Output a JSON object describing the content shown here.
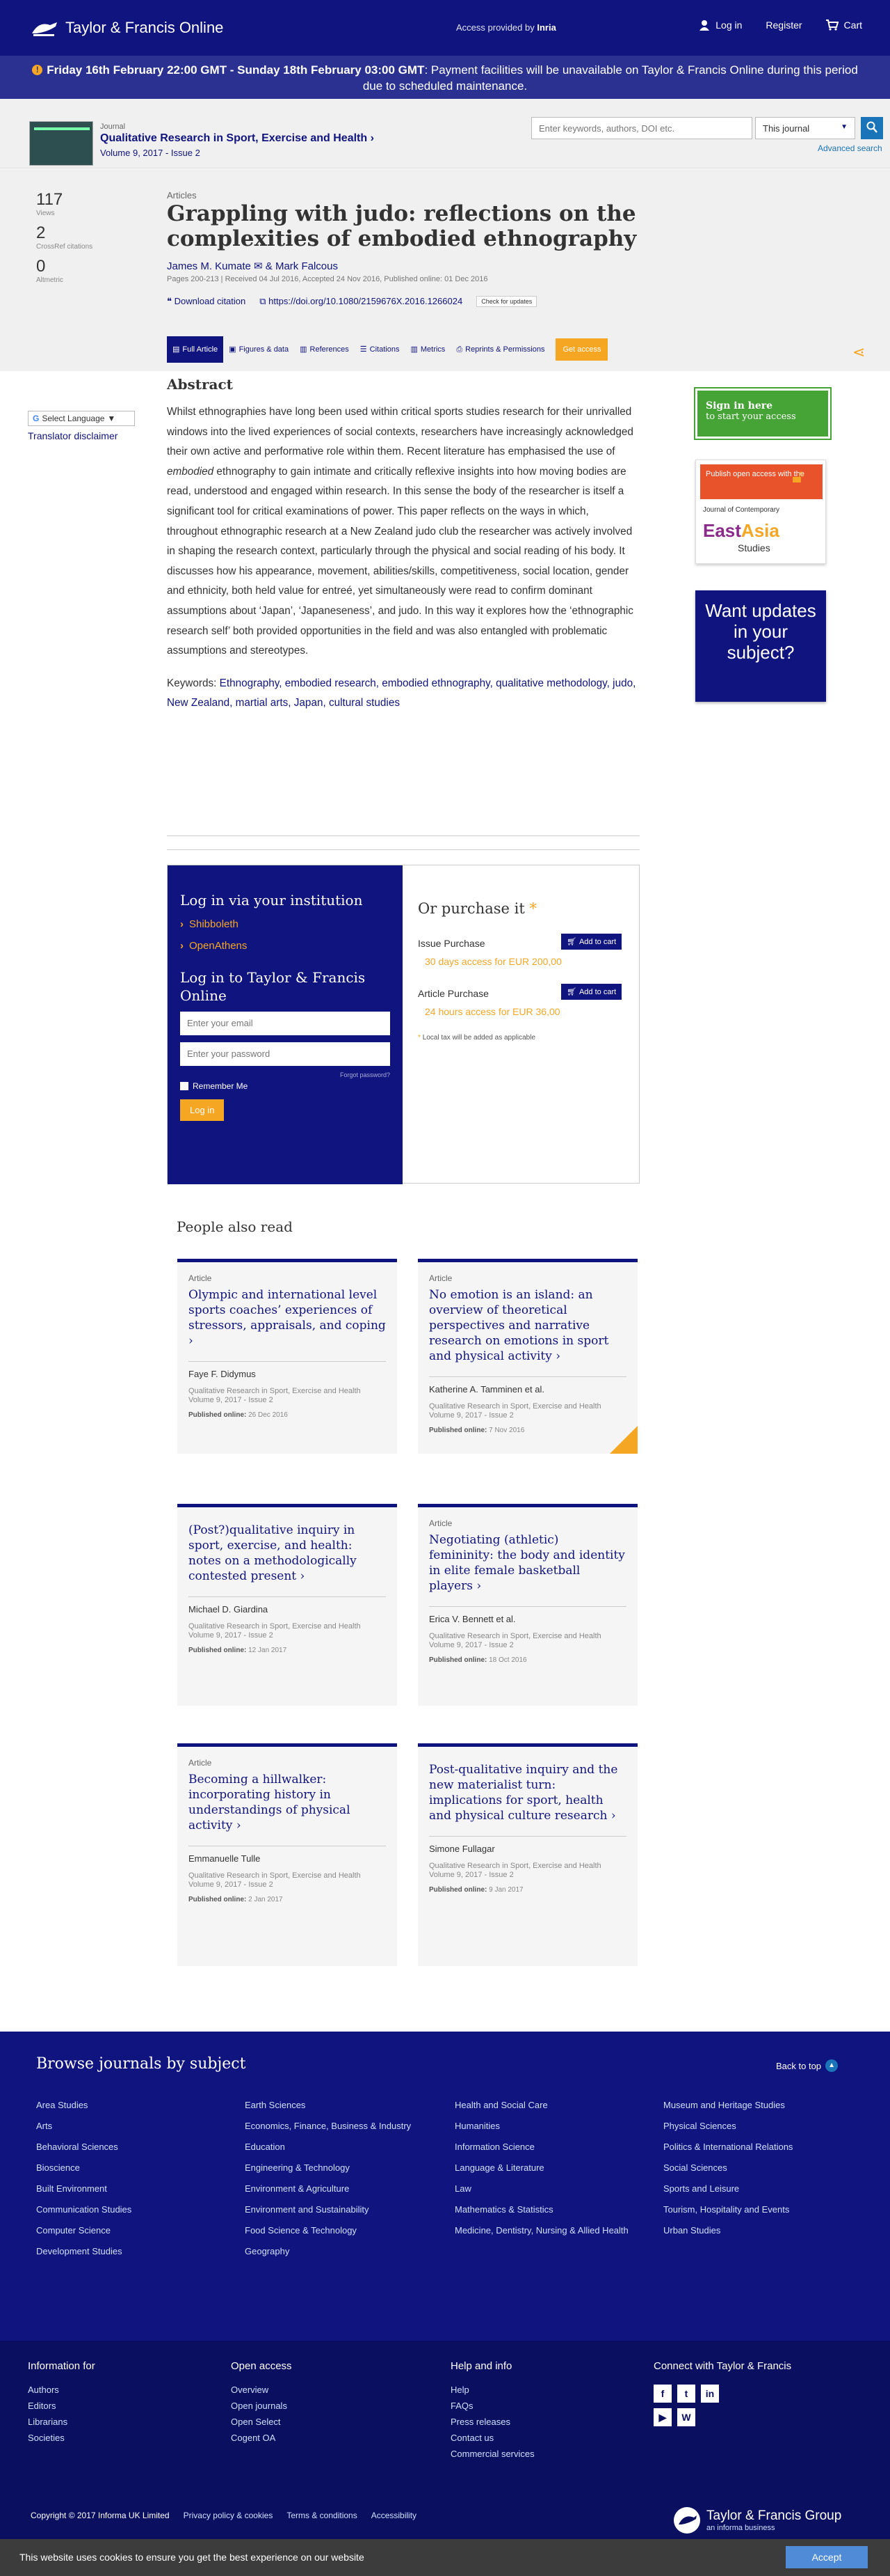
{
  "topbar": {
    "logo": "Taylor & Francis Online",
    "access_label": "Access provided by",
    "access_org": "Inria",
    "login": "Log in",
    "register": "Register",
    "cart": "Cart"
  },
  "banner": {
    "bold": "Friday 16th February 22:00 GMT - Sunday 18th February 03:00 GMT",
    "text": ": Payment facilities will be unavailable on Taylor & Francis Online during this period due to scheduled maintenance."
  },
  "journal": {
    "label": "Journal",
    "name": "Qualitative Research in Sport, Exercise and Health",
    "volume": "Volume 9, 2017 - Issue 2",
    "search_placeholder": "Enter keywords, authors, DOI etc.",
    "scope": "This journal",
    "advanced": "Advanced search"
  },
  "metrics": [
    {
      "num": "117",
      "label": "Views"
    },
    {
      "num": "2",
      "label": "CrossRef citations"
    },
    {
      "num": "0",
      "label": "Altmetric"
    }
  ],
  "article": {
    "type": "Articles",
    "title": "Grappling with judo: reflections on the complexities of embodied ethnography",
    "author1": "James M. Kumate",
    "author2": "& Mark Falcous",
    "pubinfo": "Pages 200-213 | Received 04 Jul 2016, Accepted 24 Nov 2016, Published online: 01 Dec 2016",
    "download": "Download citation",
    "doi": "https://doi.org/10.1080/2159676X.2016.1266024",
    "check": "Check for updates"
  },
  "tabs": [
    "Full Article",
    "Figures & data",
    "References",
    "Citations",
    "Metrics",
    "Reprints & Permissions"
  ],
  "get_access": "Get access",
  "lang": {
    "select": "Select Language",
    "disclaimer": "Translator disclaimer"
  },
  "abstract": {
    "heading": "Abstract",
    "p1": "Whilst ethnographies have long been used within critical sports studies research for their unrivalled windows into the lived experiences of social contexts, researchers have increasingly acknowledged their own active and performative role within them. Recent literature has emphasised the use of ",
    "em": "embodied",
    "p2": " ethnography to gain intimate and critically reflexive insights into how moving bodies are read, understood and engaged within research. In this sense the body of the researcher is itself a significant tool for critical examinations of power. This paper reflects on the ways in which, throughout ethnographic research at a New Zealand judo club the researcher was actively involved in shaping the research context, particularly through the physical and social reading of his body. It discusses how his appearance, movement, abilities/skills, competitiveness, social location, gender and ethnicity, both held value for entreé, yet simultaneously were read to confirm dominant assumptions about ‘Japan’, ‘Japaneseness’, and judo. In this way it explores how the ‘ethnographic research self’ both provided opportunities in the field and was also entangled with problematic assumptions and stereotypes.",
    "kw_label": "Keywords: ",
    "keywords": "Ethnography, embodied research, embodied ethnography, qualitative methodology, judo, New Zealand, martial arts, Japan, cultural studies"
  },
  "ads": {
    "signin_title": "Sign in here",
    "signin_sub": "to start your access",
    "oa_top": "Publish open access with the",
    "oa_journal": "Journal of Contemporary",
    "oa_east": "East",
    "oa_asia": "Asia",
    "oa_studies": "Studies",
    "updates": "Want updates in your subject?"
  },
  "access": {
    "inst_title": "Log in via your institution",
    "shib": "Shibboleth",
    "openathens": "OpenAthens",
    "tf_title": "Log in to Taylor & Francis Online",
    "email_ph": "Enter your email",
    "pass_ph": "Enter your password",
    "forgot": "Forgot password?",
    "remember": "Remember Me",
    "login_btn": "Log in",
    "purchase_title": "Or purchase it",
    "star": "*",
    "issue_title": "Issue Purchase",
    "issue_price": "30 days access for EUR 200,00",
    "article_title": "Article Purchase",
    "article_price": "24 hours access for EUR 36,00",
    "cart": "Add to cart",
    "tax": "Local tax will be added as applicable"
  },
  "par": {
    "heading": "People also read",
    "cards": [
      {
        "type": "Article",
        "title": "Olympic and international level sports coaches’ experiences of stressors, appraisals, and coping",
        "author": "Faye F. Didymus",
        "journal": "Qualitative Research in Sport, Exercise and Health",
        "volume": "Volume 9, 2017 - Issue 2",
        "pub_label": "Published online:",
        "pub_date": "26 Dec 2016"
      },
      {
        "type": "Article",
        "title": "No emotion is an island: an overview of theoretical perspectives and narrative research on emotions in sport and physical activity",
        "author": "Katherine A. Tamminen et al.",
        "journal": "Qualitative Research in Sport, Exercise and Health",
        "volume": "Volume 9, 2017 - Issue 2",
        "pub_label": "Published online:",
        "pub_date": "7 Nov 2016"
      },
      {
        "type": "",
        "title": "(Post?)qualitative inquiry in sport, exercise, and health: notes on a methodologically contested present",
        "author": "Michael D. Giardina",
        "journal": "Qualitative Research in Sport, Exercise and Health",
        "volume": "Volume 9, 2017 - Issue 2",
        "pub_label": "Published online:",
        "pub_date": "12 Jan 2017"
      },
      {
        "type": "Article",
        "title": "Negotiating (athletic) femininity: the body and identity in elite female basketball players",
        "author": "Erica V. Bennett et al.",
        "journal": "Qualitative Research in Sport, Exercise and Health",
        "volume": "Volume 9, 2017 - Issue 2",
        "pub_label": "Published online:",
        "pub_date": "18 Oct 2016"
      },
      {
        "type": "Article",
        "title": "Becoming a hillwalker: incorporating history in understandings of physical activity",
        "author": "Emmanuelle Tulle",
        "journal": "Qualitative Research in Sport, Exercise and Health",
        "volume": "Volume 9, 2017 - Issue 2",
        "pub_label": "Published online:",
        "pub_date": "2 Jan 2017"
      },
      {
        "type": "",
        "title": "Post-qualitative inquiry and the new materialist turn: implications for sport, health and physical culture research",
        "author": "Simone Fullagar",
        "journal": "Qualitative Research in Sport, Exercise and Health",
        "volume": "Volume 9, 2017 - Issue 2",
        "pub_label": "Published online:",
        "pub_date": "9 Jan 2017"
      }
    ]
  },
  "browse": {
    "heading": "Browse journals by subject",
    "back": "Back to top",
    "cols": [
      [
        "Area Studies",
        "Arts",
        "Behavioral Sciences",
        "Bioscience",
        "Built Environment",
        "Communication Studies",
        "Computer Science",
        "Development Studies"
      ],
      [
        "Earth Sciences",
        "Economics, Finance, Business & Industry",
        "Education",
        "Engineering & Technology",
        "Environment & Agriculture",
        "Environment and Sustainability",
        "Food Science & Technology",
        "Geography"
      ],
      [
        "Health and Social Care",
        "Humanities",
        "Information Science",
        "Language & Literature",
        "Law",
        "Mathematics & Statistics",
        "Medicine, Dentistry, Nursing & Allied Health"
      ],
      [
        "Museum and Heritage Studies",
        "Physical Sciences",
        "Politics & International Relations",
        "Social Sciences",
        "Sports and Leisure",
        "Tourism, Hospitality and Events",
        "Urban Studies"
      ]
    ]
  },
  "footer": {
    "info_title": "Information for",
    "info": [
      "Authors",
      "Editors",
      "Librarians",
      "Societies"
    ],
    "oa_title": "Open access",
    "oa": [
      "Overview",
      "Open journals",
      "Open Select",
      "Cogent OA"
    ],
    "help_title": "Help and info",
    "help": [
      "Help",
      "FAQs",
      "Press releases",
      "Contact us",
      "Commercial services"
    ],
    "connect_title": "Connect with Taylor & Francis",
    "copyright": "Copyright © 2017 Informa UK Limited",
    "privacy": "Privacy policy & cookies",
    "terms": "Terms & conditions",
    "accessibility": "Accessibility",
    "group": "Taylor & Francis Group",
    "group_sub": "an informa business"
  },
  "cookie": {
    "text": "This website uses cookies to ensure you get the best experience on our website",
    "accept": "Accept"
  }
}
